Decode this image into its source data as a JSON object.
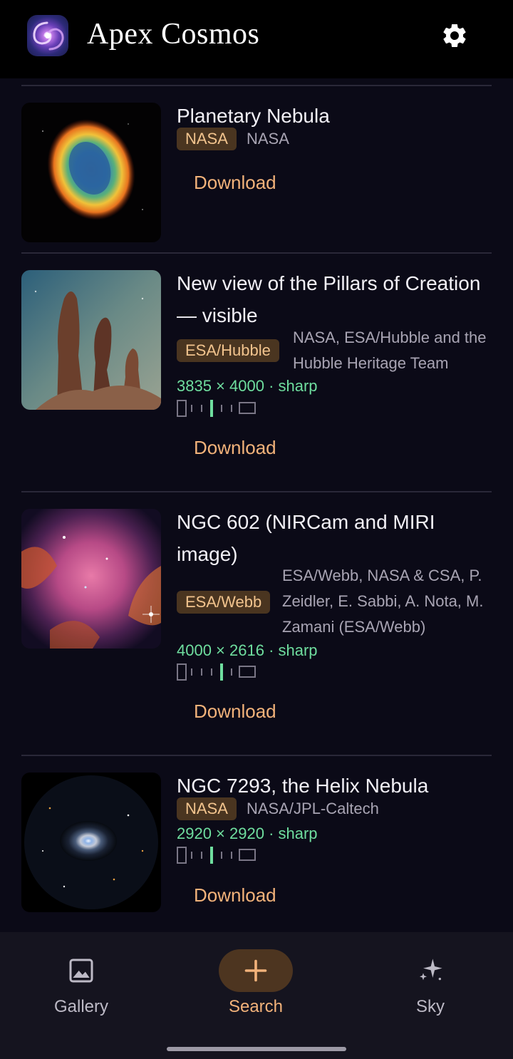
{
  "header": {
    "title": "Apex Cosmos",
    "logo_icon": "galaxy-logo-icon",
    "settings_icon": "gear-icon"
  },
  "results": [
    {
      "title": "Planetary Nebula",
      "source_badge": "NASA",
      "credit": "NASA",
      "download_label": "Download"
    },
    {
      "title": "New view of the Pillars of Creation — visible",
      "source_badge": "ESA/Hubble",
      "credit": "NASA, ESA/Hubble  and the Hubble Heritage Team",
      "resolution": "3835 × 4000 · sharp",
      "download_label": "Download"
    },
    {
      "title": "NGC 602 (NIRCam and MIRI image)",
      "source_badge": "ESA/Webb",
      "credit": "ESA/Webb, NASA & CSA, P. Zeidler, E. Sabbi, A. Nota, M. Zamani (ESA/Webb)",
      "resolution": "4000 × 2616 · sharp",
      "download_label": "Download"
    },
    {
      "title": "NGC 7293, the Helix Nebula",
      "source_badge": "NASA",
      "credit": "NASA/JPL-Caltech",
      "resolution": "2920 × 2920 · sharp",
      "download_label": "Download"
    }
  ],
  "bottom_nav": {
    "items": [
      {
        "label": "Gallery",
        "icon": "image-icon",
        "active": false
      },
      {
        "label": "Search",
        "icon": "plus-icon",
        "active": true
      },
      {
        "label": "Sky",
        "icon": "sparkle-icon",
        "active": false
      }
    ]
  },
  "colors": {
    "background": "#0b0a17",
    "accent": "#f2b27a",
    "badge_bg": "#4a3520",
    "resolution_green": "#6fde9f",
    "header_bg": "#000000"
  }
}
